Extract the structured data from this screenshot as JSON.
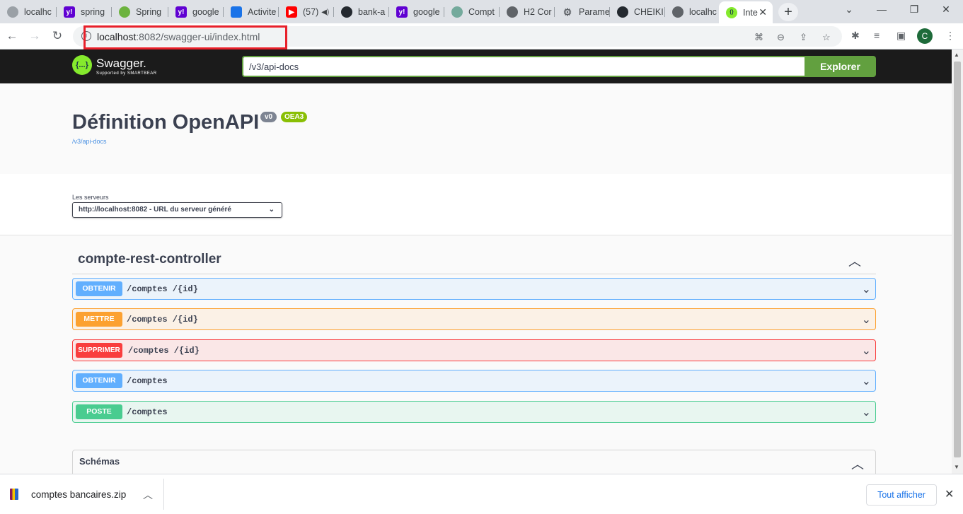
{
  "browser": {
    "tabs": [
      {
        "label": "localhc",
        "icon": "globe-icon",
        "color": "#9aa0a6"
      },
      {
        "label": "spring",
        "icon": "yahoo-icon",
        "color": "#6001d2"
      },
      {
        "label": "Spring",
        "icon": "spring-icon",
        "color": "#6db33f"
      },
      {
        "label": "google",
        "icon": "yahoo-icon",
        "color": "#6001d2"
      },
      {
        "label": "Activite",
        "icon": "user-icon",
        "color": "#1a73e8"
      },
      {
        "label": "(57)",
        "icon": "youtube-icon",
        "color": "#ff0000"
      },
      {
        "label": "bank-a",
        "icon": "github-icon",
        "color": "#24292f"
      },
      {
        "label": "google",
        "icon": "yahoo-icon",
        "color": "#6001d2"
      },
      {
        "label": "Compt",
        "icon": "openai-icon",
        "color": "#74aa9c"
      },
      {
        "label": "H2 Cor",
        "icon": "globe-icon",
        "color": "#5f6368"
      },
      {
        "label": "Parame",
        "icon": "gear-icon",
        "color": "#5f6368"
      },
      {
        "label": "CHEIKI",
        "icon": "github-icon",
        "color": "#24292f"
      },
      {
        "label": "localhc",
        "icon": "globe-icon",
        "color": "#5f6368"
      },
      {
        "label": "Inte",
        "icon": "swagger-icon",
        "color": "#85ea2d",
        "active": true
      }
    ],
    "url_host": "localhost",
    "url_rest": ":8082/swagger-ui/index.html",
    "avatar_letter": "C"
  },
  "swagger": {
    "logo_text": "Swagger.",
    "logo_sub": "Supported by SMARTBEAR",
    "logo_glyph": "{...}",
    "spec_url": "/v3/api-docs",
    "explore_label": "Explorer"
  },
  "info": {
    "title": "Définition OpenAPI",
    "version_badge": "v0",
    "oas_badge": "OEA3",
    "spec_link": "/v3/api-docs"
  },
  "servers": {
    "label": "Les serveurs",
    "selected": "http://localhost:8082 - URL du serveur généré"
  },
  "tag": {
    "name": "compte-rest-controller"
  },
  "operations": [
    {
      "method": "OBTENIR",
      "path": "/comptes /{id}",
      "kind": "get"
    },
    {
      "method": "METTRE",
      "path": "/comptes /{id}",
      "kind": "put"
    },
    {
      "method": "SUPPRIMER",
      "path": "/comptes /{id}",
      "kind": "del"
    },
    {
      "method": "OBTENIR",
      "path": "/comptes",
      "kind": "get"
    },
    {
      "method": "POSTE",
      "path": "/comptes",
      "kind": "post"
    }
  ],
  "schemas": {
    "title": "Schémas"
  },
  "download": {
    "file_name": "comptes bancaires.zip",
    "show_all_label": "Tout afficher"
  }
}
